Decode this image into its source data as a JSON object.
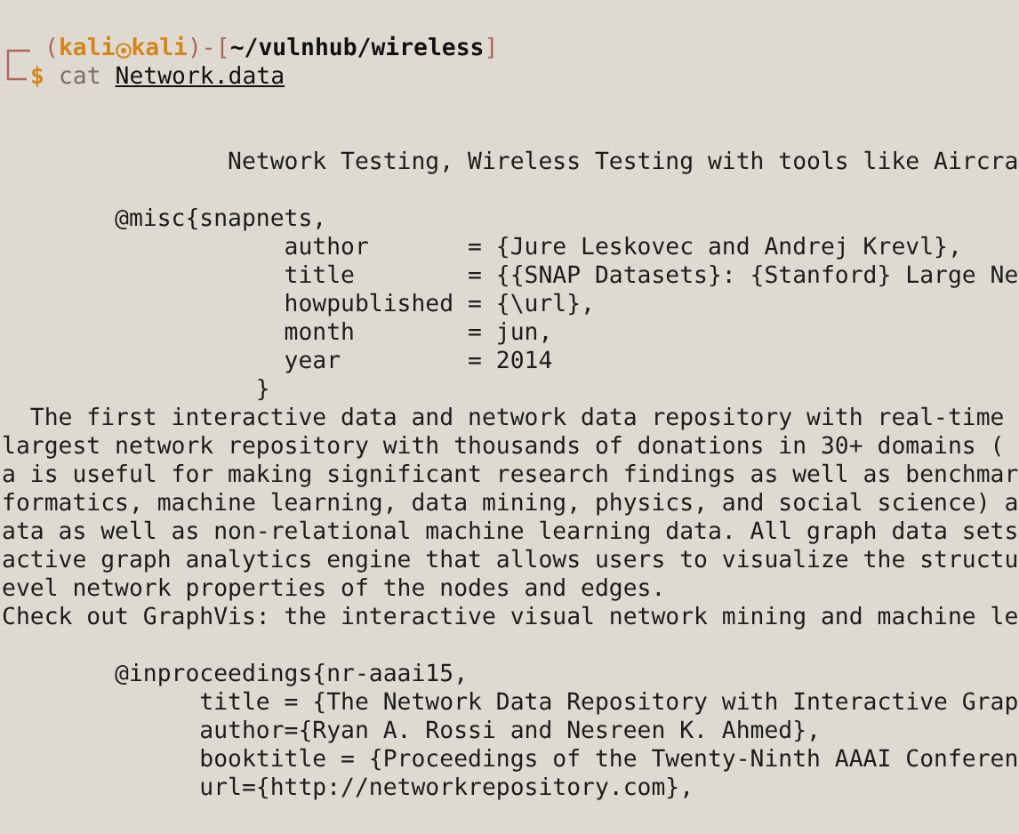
{
  "prompt": {
    "open": "(",
    "user": "kali",
    "host": "kali",
    "mid": ")-[",
    "path": "~/vulnhub/wireless",
    "close": "]",
    "symbol": "$",
    "command": "cat",
    "argument": "Network.data"
  },
  "output_blocks": [
    {
      "lines": [
        "                Network Testing, Wireless Testing with tools like Aircra"
      ]
    },
    {
      "lines": [
        "        @misc{snapnets,",
        "                    author       = {Jure Leskovec and Andrej Krevl},",
        "                    title        = {{SNAP Datasets}: {Stanford} Large Ne",
        "                    howpublished = {\\url},",
        "                    month        = jun,",
        "                    year         = 2014",
        "                  }",
        "  The first interactive data and network data repository with real-time",
        "largest network repository with thousands of donations in 30+ domains (",
        "a is useful for making significant research findings as well as benchmar",
        "formatics, machine learning, data mining, physics, and social science) a",
        "ata as well as non-relational machine learning data. All graph data sets",
        "active graph analytics engine that allows users to visualize the structu",
        "evel network properties of the nodes and edges.",
        "Check out GraphVis: the interactive visual network mining and machine le"
      ]
    },
    {
      "lines": [
        "        @inproceedings{nr-aaai15,",
        "              title = {The Network Data Repository with Interactive Grap",
        "              author={Ryan A. Rossi and Nesreen K. Ahmed},",
        "              booktitle = {Proceedings of the Twenty-Ninth AAAI Conferen",
        "              url={http://networkrepository.com},"
      ]
    }
  ]
}
